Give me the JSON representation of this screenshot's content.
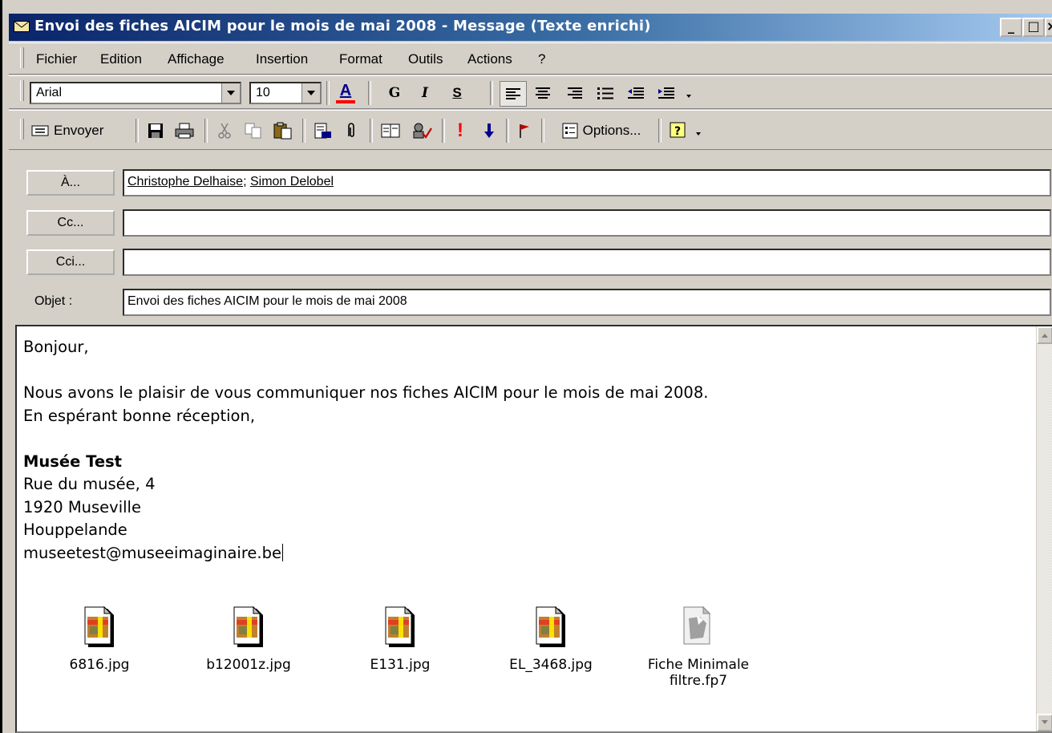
{
  "window": {
    "title": "Envoi des fiches AICIM pour le mois de mai 2008 - Message (Texte enrichi)",
    "controls": {
      "minimize": "_",
      "maximize": "□",
      "close": "×"
    }
  },
  "menu": [
    "Fichier",
    "Edition",
    "Affichage",
    "Insertion",
    "Format",
    "Outils",
    "Actions",
    "?"
  ],
  "format_toolbar": {
    "font": "Arial",
    "size": "10",
    "bold": "G",
    "italic": "I",
    "underline": "S",
    "font_color": "A",
    "font_color_value": "#ff0000"
  },
  "standard_toolbar": {
    "send": "Envoyer",
    "options": "Options..."
  },
  "header": {
    "to_button": "À...",
    "cc_button": "Cc...",
    "bcc_button": "Cci...",
    "subject_label": "Objet :",
    "to_recipients": [
      "Christophe Delhaise",
      "Simon Delobel"
    ],
    "to_separator": "; ",
    "cc_value": "",
    "bcc_value": "",
    "subject": "Envoi des fiches AICIM pour le mois de mai 2008"
  },
  "body": {
    "greeting": "Bonjour,",
    "line1": "Nous avons le plaisir de vous communiquer nos fiches AICIM pour le mois de mai 2008.",
    "line2": "En espérant bonne réception,",
    "org_name": "Musée Test",
    "address1": "Rue du musée, 4",
    "address2": "1920 Museville",
    "address3": "Houppelande",
    "email": "museetest@museeimaginaire.be"
  },
  "attachments": [
    {
      "name": "6816.jpg",
      "icon": "jpg-file-icon"
    },
    {
      "name": "b12001z.jpg",
      "icon": "jpg-file-icon"
    },
    {
      "name": "E131.jpg",
      "icon": "jpg-file-icon"
    },
    {
      "name": "EL_3468.jpg",
      "icon": "jpg-file-icon"
    },
    {
      "name_line1": "Fiche Minimale",
      "name_line2": "filtre.fp7",
      "icon": "generic-file-icon"
    }
  ]
}
